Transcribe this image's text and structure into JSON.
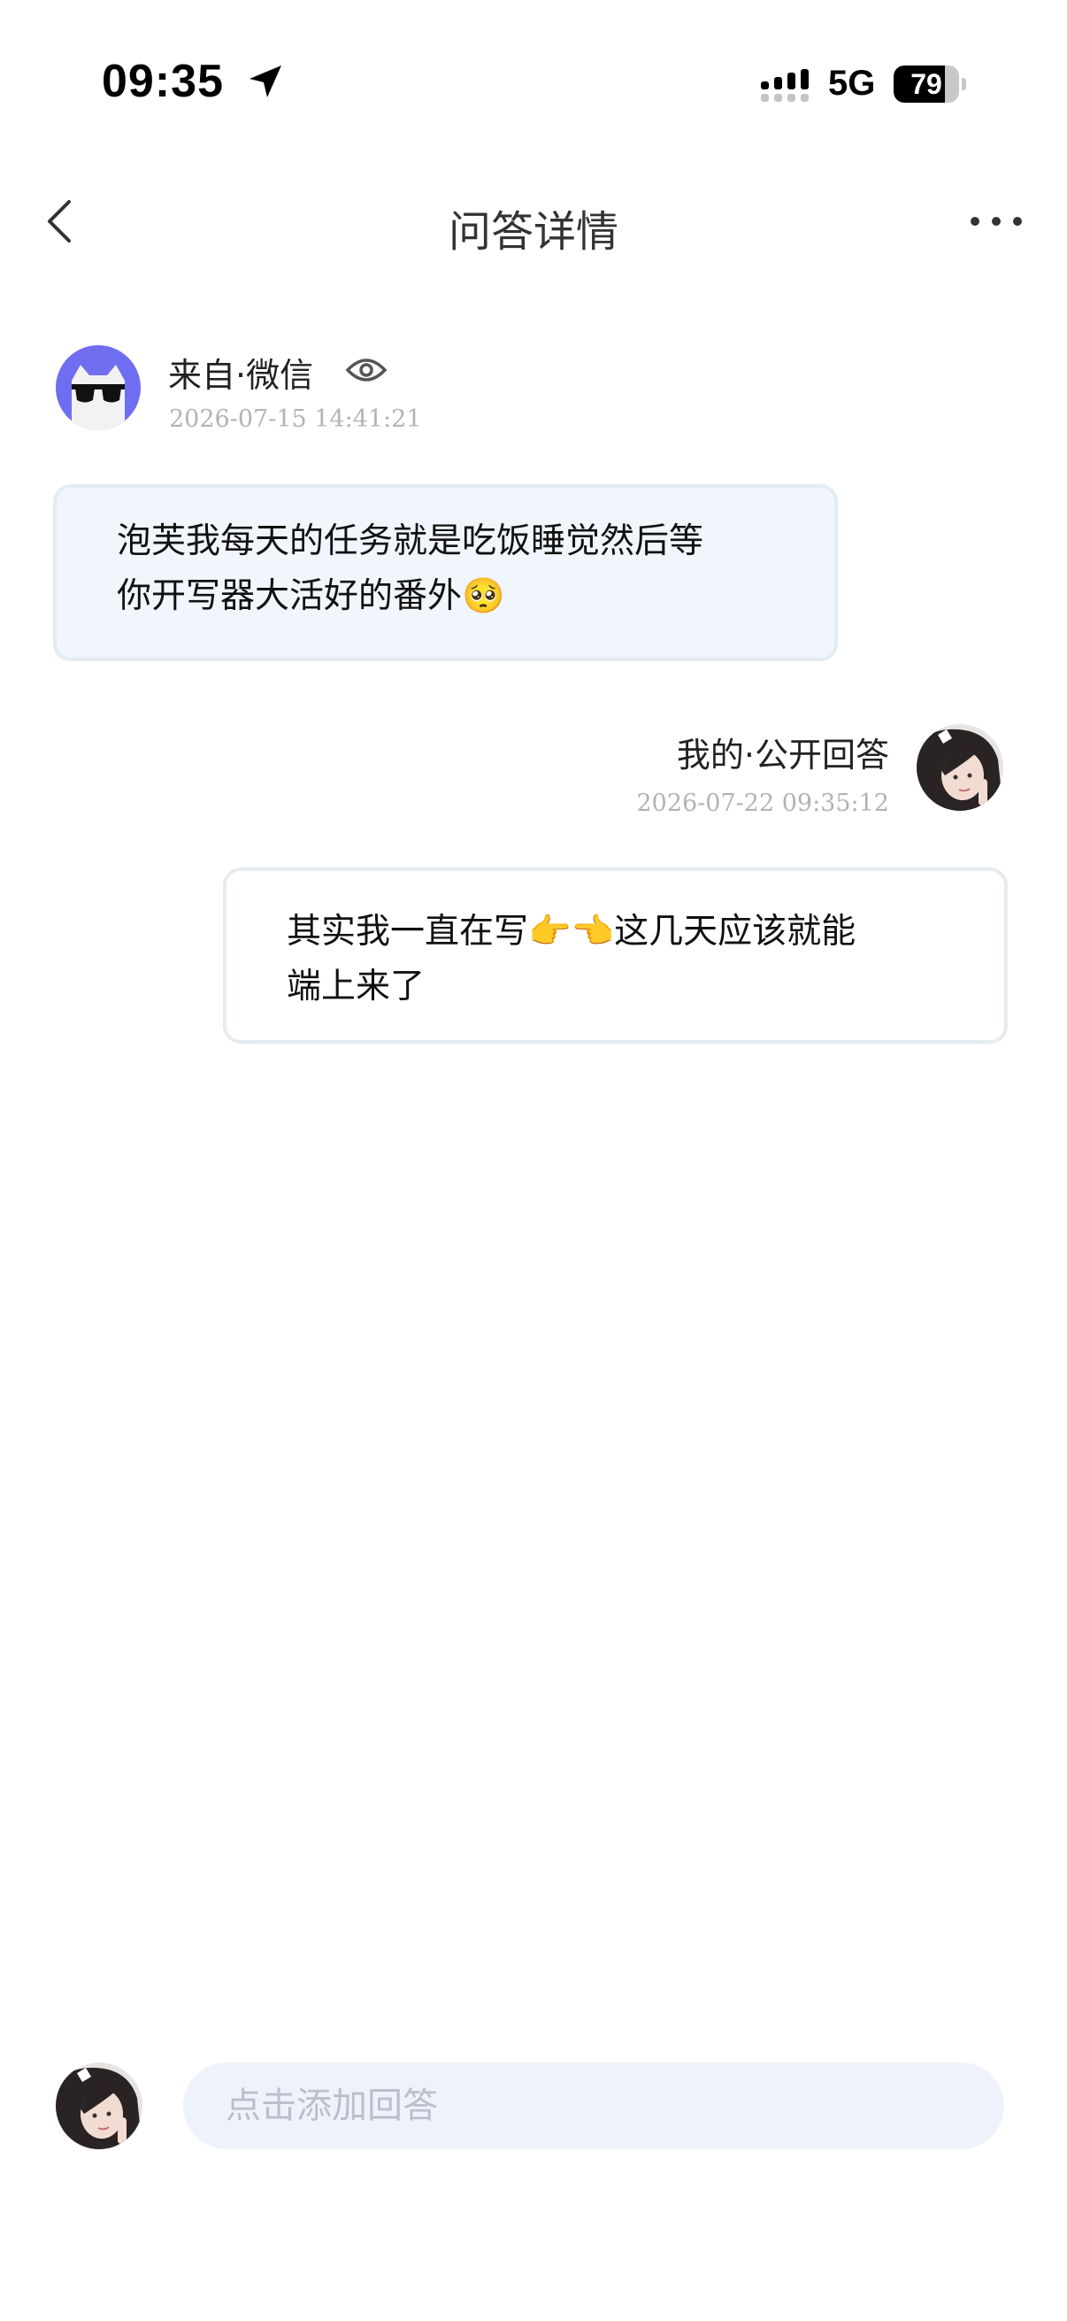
{
  "status_bar": {
    "time": "09:35",
    "network": "5G",
    "battery_level": "79",
    "battery_fraction": 0.79,
    "icons": [
      "location-arrow-icon",
      "signal-bars-icon",
      "battery-icon"
    ]
  },
  "nav": {
    "title": "问答详情",
    "icons": [
      "chevron-left-icon",
      "more-dots-icon"
    ]
  },
  "question": {
    "source": "来自·微信",
    "time": "2026-07-15 14:41:21",
    "text_line1": "泡芙我每天的任务就是吃饭睡觉然后等",
    "text_line2": "你开写器大活好的番外🥺",
    "icons": [
      "sunglasses-cat-avatar",
      "eye-icon"
    ]
  },
  "answer": {
    "label": "我的·公开回答",
    "time": "2026-07-22 09:35:12",
    "text_line1": "其实我一直在写👉👈这几天应该就能",
    "text_line2": "端上来了"
  },
  "composer": {
    "placeholder": "点击添加回答"
  },
  "colors": {
    "question_bubble_bg": "#f1f6fc",
    "input_bg": "#eef3fb",
    "avatar_purple": "#6f6df0",
    "timestamp_gray": "#b3b3b3"
  }
}
